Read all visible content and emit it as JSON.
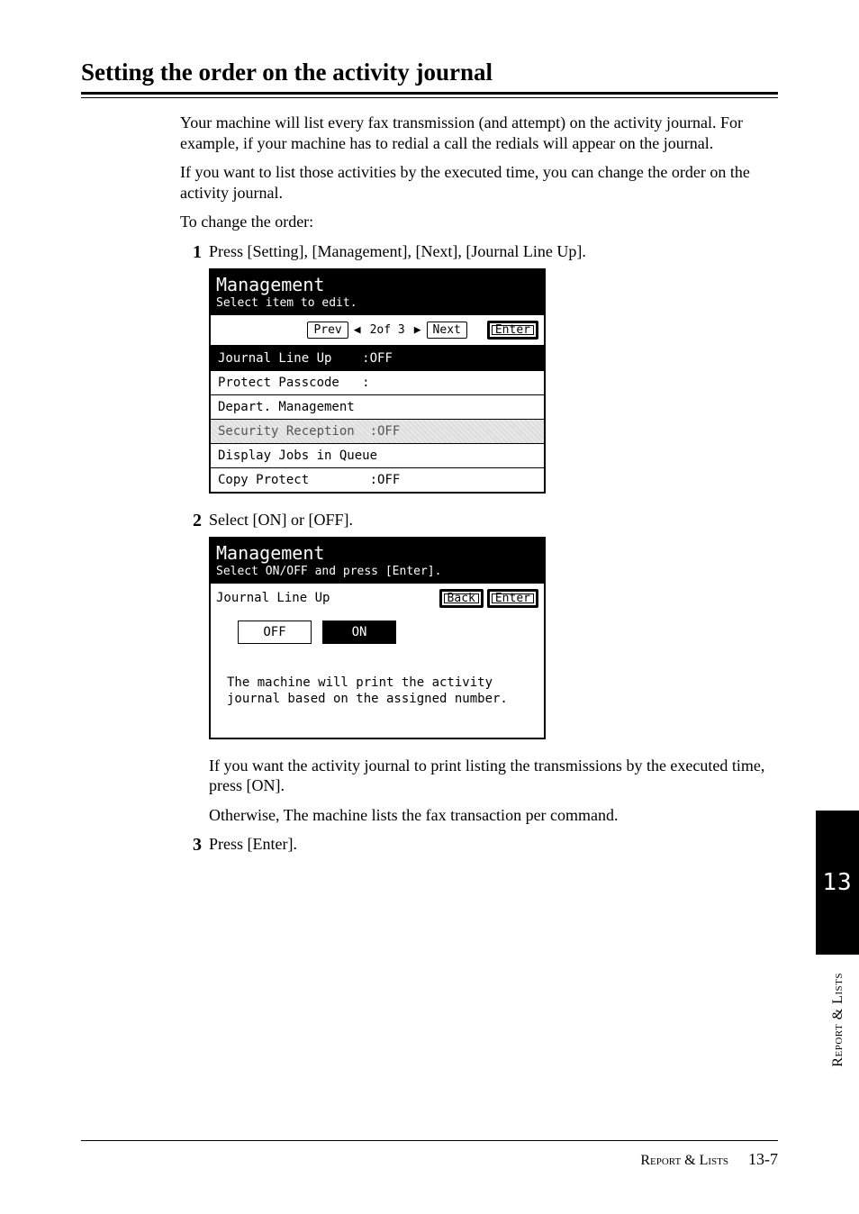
{
  "title": "Setting the order on the activity journal",
  "intro": [
    "Your machine will list every fax transmission (and attempt) on the activity journal. For example, if your machine has to redial a call the redials will appear on the journal.",
    "If you want to list those activities by the executed time, you can change the order on the activity journal.",
    "To change the order:"
  ],
  "steps": {
    "s1": {
      "num": "1",
      "text": "Press [Setting], [Management], [Next], [Journal Line Up]."
    },
    "s2": {
      "num": "2",
      "text": "Select [ON] or [OFF]."
    },
    "s3": {
      "num": "3",
      "text": "Press [Enter]."
    }
  },
  "post2": [
    "If you want the activity journal to print listing the transmissions by the executed time, press [ON].",
    "Otherwise, The machine lists the fax transaction per command."
  ],
  "lcd1": {
    "title": "Management",
    "subtitle": "Select item to edit.",
    "nav": {
      "prev": "Prev",
      "page": "2of 3",
      "next": "Next",
      "enter": "Enter"
    },
    "rows": [
      {
        "label": "Journal Line Up",
        "value": ":OFF",
        "sel": true
      },
      {
        "label": "Protect Passcode",
        "value": ":",
        "sel": false
      },
      {
        "label": "Depart. Management",
        "value": "",
        "sel": false
      },
      {
        "label": "Security Reception",
        "value": ":OFF",
        "dis": true
      },
      {
        "label": "Display Jobs in Queue",
        "value": "",
        "sel": false
      },
      {
        "label": "Copy Protect",
        "value": ":OFF",
        "sel": false
      }
    ]
  },
  "lcd2": {
    "title": "Management",
    "subtitle": "Select ON/OFF and press [Enter].",
    "label": "Journal Line Up",
    "back": "Back",
    "enter": "Enter",
    "off": "OFF",
    "on": "ON",
    "desc": "The machine will print the activity journal based on the assigned number."
  },
  "side": {
    "tab": "13",
    "label": "Report & Lists"
  },
  "footer": {
    "label": "Report & Lists",
    "page": "13-7"
  }
}
